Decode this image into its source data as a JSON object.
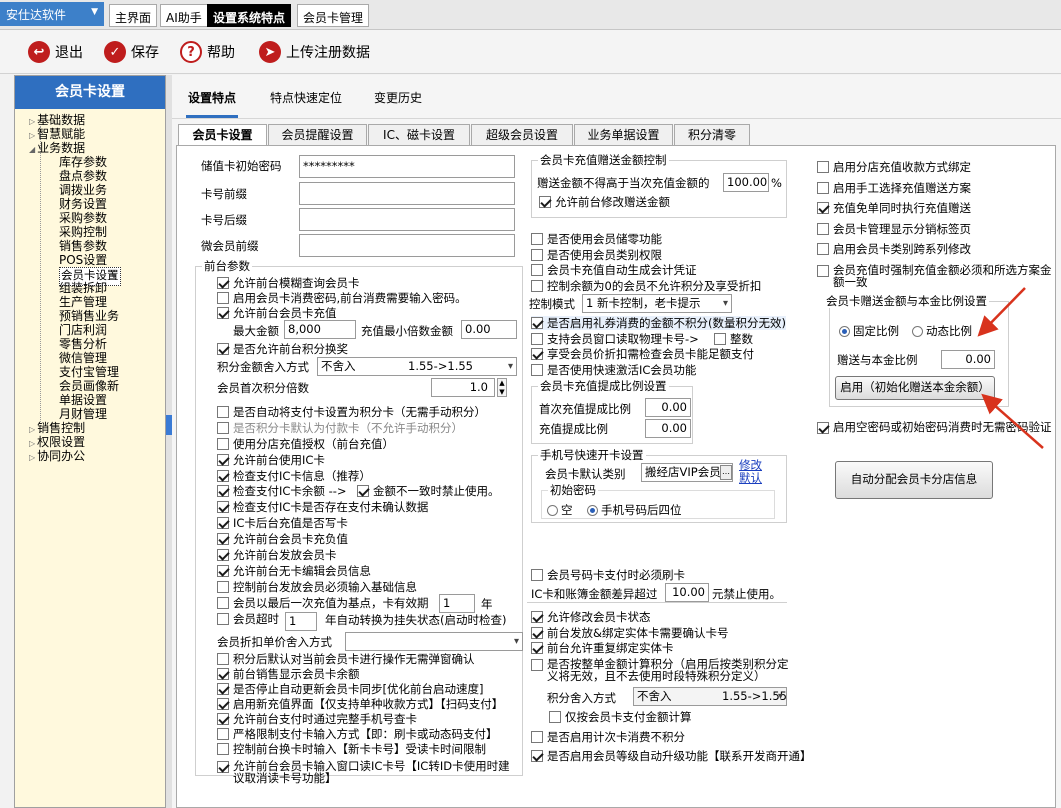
{
  "app": {
    "name": "安仕达软件",
    "tabs": [
      "主界面",
      "AI助手",
      "设置系统特点",
      "会员卡管理"
    ]
  },
  "toolbar": {
    "exit": "退出",
    "save": "保存",
    "help": "帮助",
    "upload": "上传注册数据"
  },
  "sidebar": {
    "title": "会员卡设置",
    "top_nodes": [
      "基础数据",
      "智慧赋能",
      "业务数据"
    ],
    "business_items": [
      "库存参数",
      "盘点参数",
      "调拨业务",
      "财务设置",
      "采购参数",
      "采购控制",
      "销售参数",
      "POS设置",
      "会员卡设置",
      "组装拆卸",
      "生产管理",
      "预销售业务",
      "门店利润",
      "零售分析",
      "微信管理",
      "支付宝管理",
      "会员画像新",
      "单据设置",
      "月财管理"
    ],
    "bottom_nodes": [
      "销售控制",
      "权限设置",
      "协同办公"
    ]
  },
  "subtabs": [
    "设置特点",
    "特点快速定位",
    "变更历史"
  ],
  "inner_tabs": [
    "会员卡设置",
    "会员提醒设置",
    "IC、磁卡设置",
    "超级会员设置",
    "业务单据设置",
    "积分清零"
  ],
  "left": {
    "stored_pw_label": "储值卡初始密码",
    "stored_pw": "*********",
    "prefix_label": "卡号前缀",
    "suffix_label": "卡号后缀",
    "wx_prefix_label": "微会员前缀",
    "front_group": "前台参数",
    "cb1": "允许前台模糊查询会员卡",
    "cb2": "启用会员卡消费密码,前台消费需要输入密码。",
    "cb3": "允许前台会员卡充值",
    "max_amount_label": "最大金额",
    "max_amount": "8,000",
    "min_multiple_label": "充值最小倍数金额",
    "min_multiple": "0.00",
    "cb4": "是否允许前台积分换奖",
    "rounding_label": "积分金额舍入方式",
    "rounding_value": "不舍入",
    "rounding_range": "1.55->1.55",
    "first_ratio_label": "会员首次积分倍数",
    "first_ratio": "1.0",
    "items_a": [
      {
        "t": "是否自动将支付卡设置为积分卡（无需手动积分）",
        "on": false
      },
      {
        "t": "是否积分卡默认为付款卡（不允许手动积分）",
        "on": false,
        "dim": true
      },
      {
        "t": "使用分店充值授权（前台充值）",
        "on": false
      },
      {
        "t": "允许前台使用IC卡",
        "on": true
      },
      {
        "t": "检查支付IC卡信息（推荐）",
        "on": true
      }
    ],
    "ic_balance": "检查支付IC卡余额 -->",
    "ic_mismatch": "金额不一致时禁止使用。",
    "items_b": [
      {
        "t": "检查支付IC卡是否存在支付未确认数据",
        "on": true
      },
      {
        "t": "IC卡后台充值是否写卡",
        "on": true
      },
      {
        "t": "允许前台会员卡充负值",
        "on": true
      },
      {
        "t": "允许前台发放会员卡",
        "on": true
      },
      {
        "t": "允许前台无卡编辑会员信息",
        "on": true
      },
      {
        "t": "控制前台发放会员必须输入基础信息",
        "on": false
      }
    ],
    "valid_label": "会员以最后一次充值为基点，卡有效期",
    "valid_val": "1",
    "valid_unit": "年",
    "overtime_label": "会员超时",
    "overtime_val": "1",
    "overtime_tail": "年自动转换为挂失状态(启动时检查)",
    "discount_label": "会员折扣单价舍入方式",
    "items_c": [
      {
        "t": "积分后默认对当前会员卡进行操作无需弹窗确认",
        "on": false
      },
      {
        "t": "前台销售显示会员卡余额",
        "on": true
      },
      {
        "t": "是否停止自动更新会员卡同步[优化前台启动速度]",
        "on": true
      },
      {
        "t": "启用新充值界面【仅支持单种收款方式】【扫码支付】",
        "on": true
      },
      {
        "t": "允许前台支付时通过完整手机号查卡",
        "on": true
      },
      {
        "t": "严格限制支付卡输入方式【即：刷卡或动态码支付】",
        "on": false
      },
      {
        "t": "控制前台换卡时输入【新卡卡号】受读卡时间限制",
        "on": false
      }
    ],
    "last_cb": "允许前台会员卡输入窗口读IC卡号【IC转ID卡使用时建议取消读卡号功能】"
  },
  "mid": {
    "gift_group": "会员卡充值赠送金额控制",
    "gift_limit_label": "赠送金额不得高于当次充值金额的",
    "gift_limit": "100.00",
    "pct": "%",
    "gift_edit": "允许前台修改赠送金额",
    "items_a": [
      {
        "t": "是否使用会员储零功能",
        "on": false
      },
      {
        "t": "是否使用会员类别权限",
        "on": false
      },
      {
        "t": "会员卡充值自动生成会计凭证",
        "on": false
      },
      {
        "t": "控制余额为0的会员不允许积分及享受折扣",
        "on": false
      }
    ],
    "ctrl_mode_label": "控制模式",
    "ctrl_mode": "1 新卡控制，老卡提示",
    "items_b": [
      {
        "t": "是否启用礼券消费的金额不积分(数量积分无效)",
        "on": true,
        "hl": true
      },
      {
        "t": "支持会员窗口读取物理卡号->",
        "on": false
      }
    ],
    "integer_label": "整数",
    "items_c": [
      {
        "t": "享受会员价折扣需检查会员卡能足额支付",
        "on": true
      },
      {
        "t": "是否使用快速激活IC会员功能",
        "on": false
      }
    ],
    "commission_group": "会员卡充值提成比例设置",
    "first_comm_label": "首次充值提成比例",
    "first_comm": "0.00",
    "comm_label": "充值提成比例",
    "comm": "0.00",
    "phone_group": "手机号快速开卡设置",
    "default_type_label": "会员卡默认类别",
    "default_type": "搬经店VIP会员",
    "modify": "修改",
    "default": "默认",
    "init_pw_group": "初始密码",
    "pw_empty": "空",
    "pw_phone": "手机号码后四位",
    "swipe": "会员号码卡支付时必须刷卡",
    "ic_diff_label": "IC卡和账簿金额差异超过",
    "ic_diff": "10.00",
    "ic_diff_tail": "元禁止使用。",
    "items_d": [
      {
        "t": "允许修改会员卡状态",
        "on": true
      },
      {
        "t": "前台发放&绑定实体卡需要确认卡号",
        "on": true
      },
      {
        "t": "前台允许重复绑定实体卡",
        "on": true
      }
    ],
    "int_points": "是否按整单金额计算积分（启用后按类别积分定义将无效，且不去使用时段特殊积分定义）",
    "pts_round_label": "积分舍入方式",
    "pts_round": "不舍入",
    "pts_round_range": "1.55->1.55",
    "only_card": "仅按会员卡支付金额计算",
    "times_card": "是否启用计次卡消费不积分",
    "level_up": "是否启用会员等级自动升级功能【联系开发商开通】"
  },
  "right": {
    "items": [
      {
        "t": "启用分店充值收款方式绑定",
        "on": false
      },
      {
        "t": "启用手工选择充值赠送方案",
        "on": false
      },
      {
        "t": "充值免单同时执行充值赠送",
        "on": true
      },
      {
        "t": "会员卡管理显示分销标签页",
        "on": false
      },
      {
        "t": "启用会员卡类别跨系列修改",
        "on": false
      }
    ],
    "force_gift": "会员充值时强制充值金额必须和所选方案金额一致",
    "ratio_group": "会员卡赠送金额与本金比例设置",
    "fixed": "固定比例",
    "dynamic": "动态比例",
    "ratio_label": "赠送与本金比例",
    "ratio": "0.00",
    "enable_btn": "启用（初始化赠送本金余额）",
    "empty_pw": "启用空密码或初始密码消费时无需密码验证",
    "assign_btn": "自动分配会员卡分店信息"
  }
}
